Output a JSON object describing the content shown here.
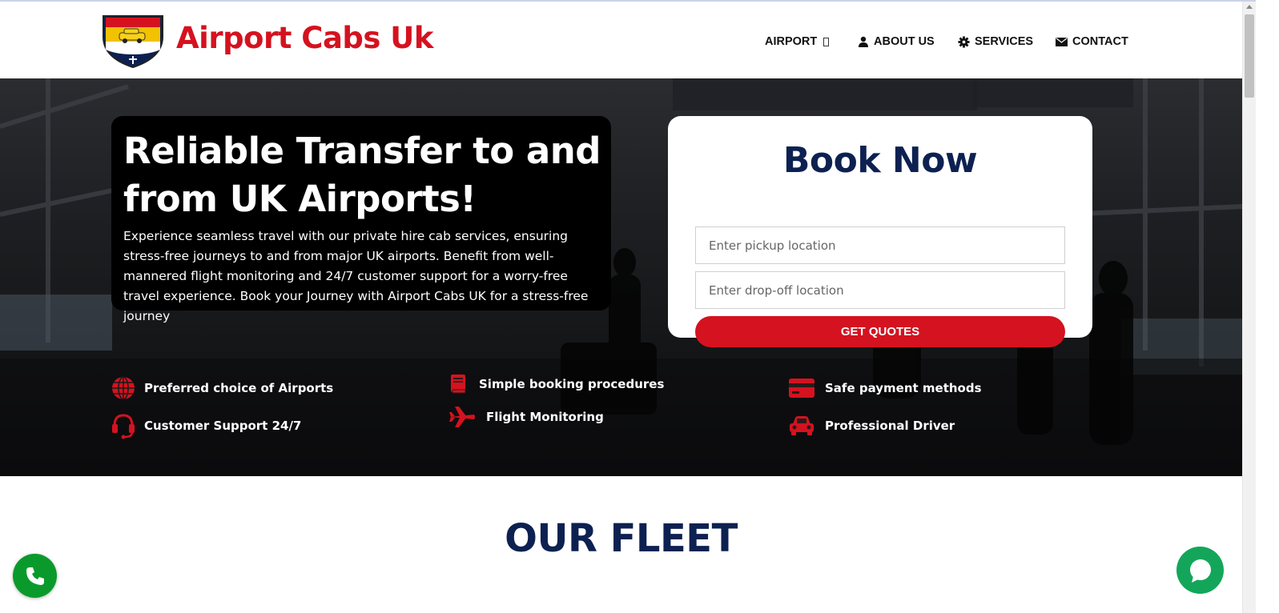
{
  "header": {
    "brand": "Airport Cabs Uk",
    "logo_text": "AIRPORT CABS UK",
    "nav": [
      {
        "label": "AIRPORT",
        "icon": "dropdown-caret-icon"
      },
      {
        "label": "ABOUT US",
        "icon": "user-icon"
      },
      {
        "label": "SERVICES",
        "icon": "gear-icon"
      },
      {
        "label": "CONTACT",
        "icon": "envelope-icon"
      }
    ]
  },
  "hero": {
    "title": "Reliable Transfer to and from UK Airports!",
    "description": "Experience seamless travel with our private hire cab services, ensuring stress-free journeys to and from major UK airports. Benefit from well-mannered flight monitoring and 24/7 customer support for a worry-free travel experience. Book your Journey with Airport Cabs UK for a stress-free journey"
  },
  "booking": {
    "title": "Book Now",
    "pickup_placeholder": "Enter pickup location",
    "dropoff_placeholder": "Enter drop-off location",
    "button": "GET QUOTES"
  },
  "features": [
    {
      "label": "Preferred choice of Airports",
      "icon": "globe-icon"
    },
    {
      "label": "Customer Support 24/7",
      "icon": "headset-icon"
    },
    {
      "label": "Simple booking procedures",
      "icon": "book-icon"
    },
    {
      "label": "Flight Monitoring",
      "icon": "plane-icon"
    },
    {
      "label": "Safe payment methods",
      "icon": "credit-card-icon"
    },
    {
      "label": "Professional Driver",
      "icon": "car-icon"
    }
  ],
  "fleet": {
    "title": "OUR FLEET"
  },
  "colors": {
    "brand_red": "#d5121f",
    "navy": "#0d2151",
    "call_green": "#0a9a2c",
    "chat_green": "#13a65a"
  }
}
